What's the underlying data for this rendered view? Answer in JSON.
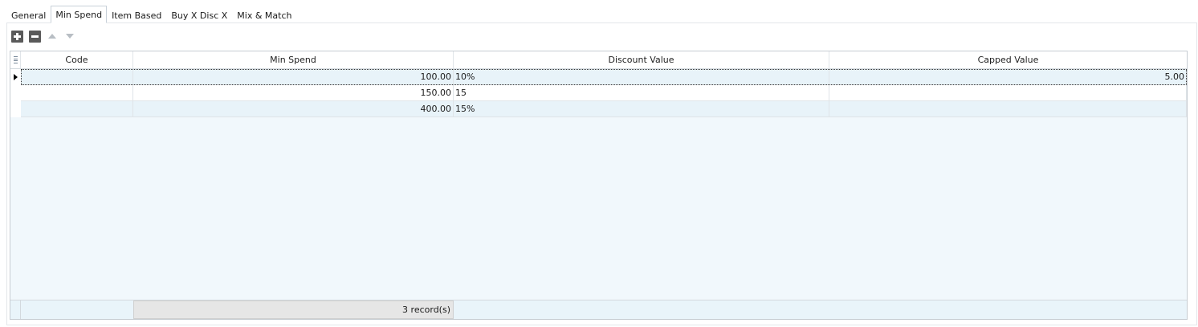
{
  "tabs": [
    {
      "label": "General",
      "active": false
    },
    {
      "label": "Min Spend",
      "active": true
    },
    {
      "label": "Item Based",
      "active": false
    },
    {
      "label": "Buy X Disc X",
      "active": false
    },
    {
      "label": "Mix & Match",
      "active": false
    }
  ],
  "toolbar": {
    "add_icon": "plus-square-icon",
    "remove_icon": "minus-square-icon",
    "move_up_icon": "triangle-up-icon",
    "move_down_icon": "triangle-down-icon"
  },
  "grid": {
    "columns": [
      "Code",
      "Min Spend",
      "Discount Value",
      "Capped Value"
    ],
    "rows": [
      {
        "code": "",
        "min_spend": "100.00",
        "discount_value": "10%",
        "capped_value": "5.00"
      },
      {
        "code": "",
        "min_spend": "150.00",
        "discount_value": "15",
        "capped_value": ""
      },
      {
        "code": "",
        "min_spend": "400.00",
        "discount_value": "15%",
        "capped_value": ""
      }
    ],
    "selected_row": 0,
    "footer_summary": "3 record(s)"
  },
  "colors": {
    "grid_background": "#f1f8fc",
    "alt_row": "#e8f3f9",
    "button_gray": "#5a5a5a"
  }
}
